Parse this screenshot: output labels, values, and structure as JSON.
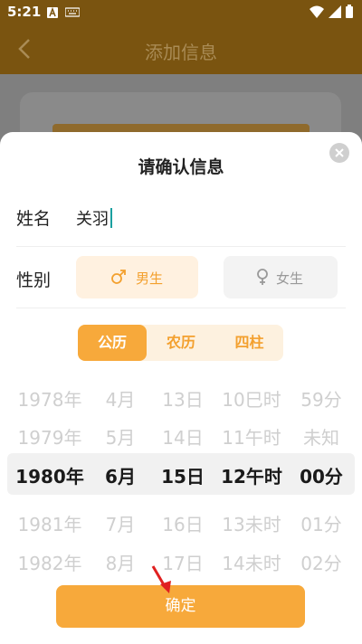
{
  "status_bar": {
    "time": "5:21"
  },
  "app_bar": {
    "title": "添加信息"
  },
  "dialog": {
    "title": "请确认信息",
    "name_label": "姓名",
    "name_value": "关羽",
    "gender_label": "性别",
    "gender_options": [
      "男生",
      "女生"
    ],
    "gender_selected": "男生",
    "calendar_tabs": [
      "公历",
      "农历",
      "四柱"
    ],
    "calendar_selected": "公历",
    "picker": {
      "years": [
        "1978年",
        "1979年",
        "1980年",
        "1981年",
        "1982年"
      ],
      "months": [
        "4月",
        "5月",
        "6月",
        "7月",
        "8月"
      ],
      "days": [
        "13日",
        "14日",
        "15日",
        "16日",
        "17日"
      ],
      "hours": [
        "10巳时",
        "11午时",
        "12午时",
        "13未时",
        "14未时"
      ],
      "minutes": [
        "59分",
        "未知",
        "00分",
        "01分",
        "02分"
      ]
    },
    "confirm_label": "确定"
  },
  "colors": {
    "accent": "#f7a93b",
    "header": "#7a5410"
  }
}
